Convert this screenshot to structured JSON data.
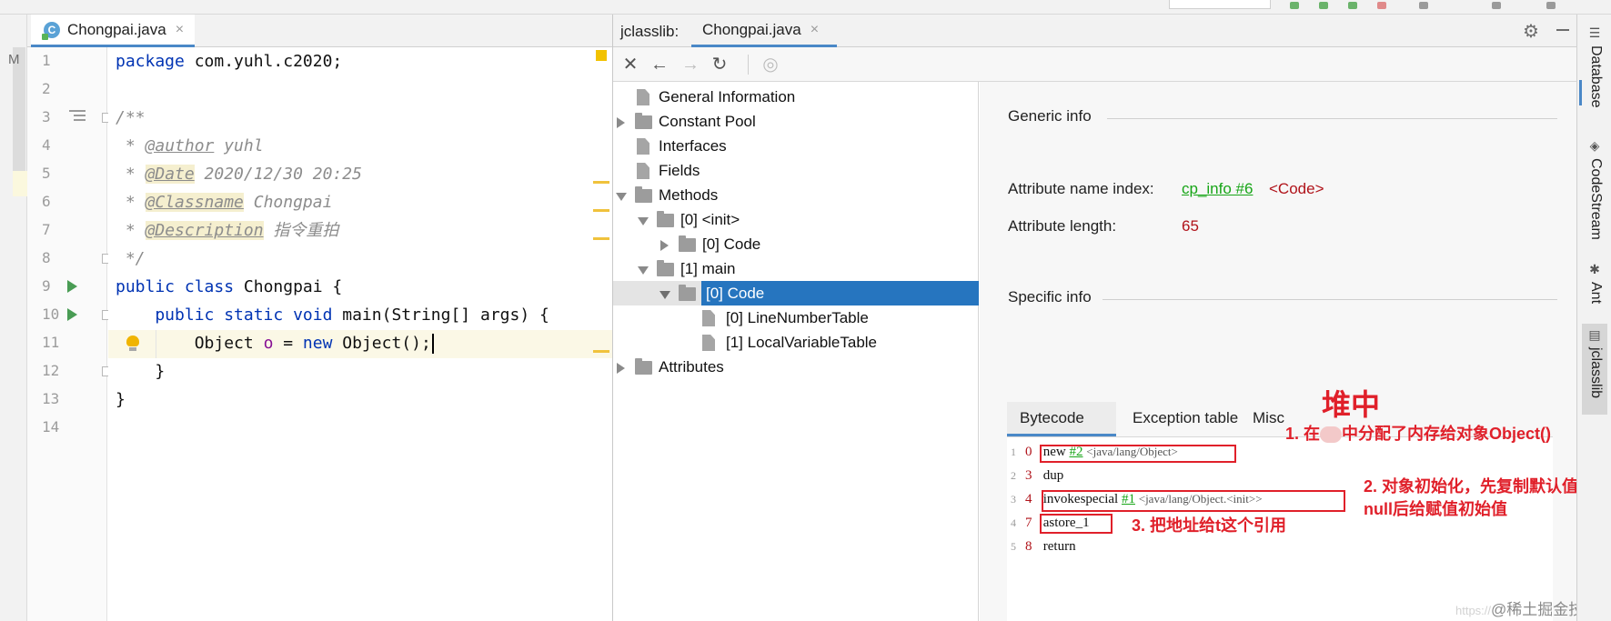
{
  "editor": {
    "tab_title": "Chongpai.java",
    "tab_close": "×",
    "file_icon_letter": "C",
    "left_strip_letter": "M",
    "line_numbers": [
      "1",
      "2",
      "3",
      "4",
      "5",
      "6",
      "7",
      "8",
      "9",
      "10",
      "11",
      "12",
      "13",
      "14"
    ],
    "code": {
      "l1_kw": "package",
      "l1_rest": " com.yuhl.c2020;",
      "l3": "/**",
      "l4_star": " * ",
      "l4_tag": "@author",
      "l4_val": " yuhl",
      "l5_star": " * ",
      "l5_tag": "@Date",
      "l5_val": " 2020/12/30 20:25",
      "l6_star": " * ",
      "l6_tag": "@Classname",
      "l6_val": " Chongpai",
      "l7_star": " * ",
      "l7_tag": "@Description",
      "l7_val": " 指令重拍",
      "l8": " */",
      "l9_kw1": "public",
      "l9_kw2": " class",
      "l9_rest": " Chongpai {",
      "l10_kw1": "    public",
      "l10_kw2": " static",
      "l10_kw3": " void",
      "l10_rest": " main(String[] args) {",
      "l11_a": "        Object ",
      "l11_var": "o",
      "l11_b": " = ",
      "l11_kw": "new",
      "l11_c": " Object();",
      "l12": "    }",
      "l13": "}"
    }
  },
  "jclasslib": {
    "panel_label": "jclasslib:",
    "tab_title": "Chongpai.java",
    "tab_close": "×",
    "tree": [
      {
        "label": "General Information"
      },
      {
        "label": "Constant Pool"
      },
      {
        "label": "Interfaces"
      },
      {
        "label": "Fields"
      },
      {
        "label": "Methods"
      },
      {
        "label": "[0] <init>"
      },
      {
        "label": "[0] Code"
      },
      {
        "label": "[1] main"
      },
      {
        "label": "[0] Code"
      },
      {
        "label": "[0] LineNumberTable"
      },
      {
        "label": "[1] LocalVariableTable"
      },
      {
        "label": "Attributes"
      }
    ],
    "generic_info_title": "Generic info",
    "attr_name_index_label": "Attribute name index:",
    "attr_name_index_link": "cp_info #6",
    "attr_name_index_value": "<Code>",
    "attr_length_label": "Attribute length:",
    "attr_length_value": "65",
    "specific_info_title": "Specific info",
    "sub_tabs": [
      "Bytecode",
      "Exception table",
      "Misc"
    ],
    "bytecode": [
      {
        "line": "1",
        "offset": "0",
        "op": "new",
        "ref": "#2",
        "comment": "<java/lang/Object>"
      },
      {
        "line": "2",
        "offset": "3",
        "op": "dup",
        "ref": "",
        "comment": ""
      },
      {
        "line": "3",
        "offset": "4",
        "op": "invokespecial",
        "ref": "#1",
        "comment": "<java/lang/Object.<init>>"
      },
      {
        "line": "4",
        "offset": "7",
        "op": "astore_1",
        "ref": "",
        "comment": ""
      },
      {
        "line": "5",
        "offset": "8",
        "op": "return",
        "ref": "",
        "comment": ""
      }
    ]
  },
  "annotations": {
    "heap": "堆中",
    "note1_a": "1. 在",
    "note1_b": "中分配了内存给对象Object()",
    "note2_line1": "2. 对象初始化，先复制默认值",
    "note2_line2": "null后给赋值初始值",
    "note3": "3. 把地址给t这个引用"
  },
  "right_toolbar": [
    "Database",
    "CodeStream",
    "Ant",
    "jclasslib"
  ],
  "watermark": {
    "faint": "https://",
    "main": "@稀土掘金技术社区"
  },
  "colors": {
    "selection": "#2675bf",
    "accent": "#4a88c7",
    "keyword": "#0033b3",
    "link_green": "#17a517",
    "value_red": "#b0131a",
    "annotation_red": "#e0202a"
  }
}
